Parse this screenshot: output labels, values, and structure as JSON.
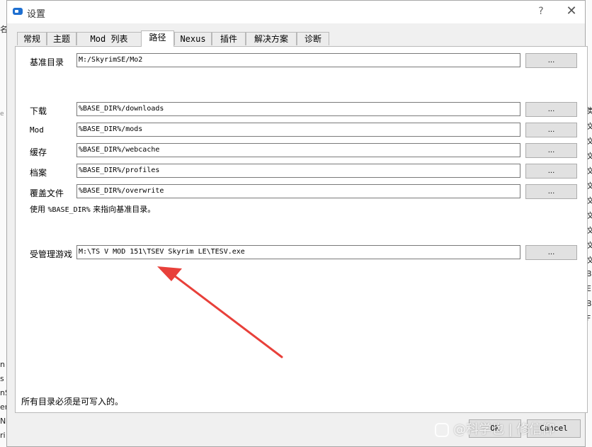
{
  "window": {
    "title": "设置",
    "help_symbol": "?",
    "close_symbol": "✕"
  },
  "tabs": [
    {
      "label": "常规"
    },
    {
      "label": "主题"
    },
    {
      "label": "Mod 列表"
    },
    {
      "label": "路径"
    },
    {
      "label": "Nexus"
    },
    {
      "label": "插件"
    },
    {
      "label": "解决方案"
    },
    {
      "label": "诊断"
    }
  ],
  "active_tab": "路径",
  "paths": {
    "base": {
      "label": "基准目录",
      "value": "M:/SkyrimSE/Mo2",
      "browse": "..."
    },
    "downloads": {
      "label": "下载",
      "value": "%BASE_DIR%/downloads",
      "browse": "..."
    },
    "mods": {
      "label": "Mod",
      "value": "%BASE_DIR%/mods",
      "browse": "..."
    },
    "cache": {
      "label": "缓存",
      "value": "%BASE_DIR%/webcache",
      "browse": "..."
    },
    "profiles": {
      "label": "档案",
      "value": "%BASE_DIR%/profiles",
      "browse": "..."
    },
    "overwrite": {
      "label": "覆盖文件",
      "value": "%BASE_DIR%/overwrite",
      "browse": "..."
    },
    "managed_game": {
      "label": "受管理游戏",
      "value": "M:\\TS V MOD 151\\TSEV Skyrim LE\\TESV.exe",
      "browse": "..."
    }
  },
  "notes": {
    "base_dir_prefix": "使用 ",
    "base_dir_token": "%BASE_DIR%",
    "base_dir_suffix": " 来指向基准目录。",
    "writable": "所有目录必须是可写入的。"
  },
  "buttons": {
    "ok": "OK",
    "cancel": "Cancel"
  },
  "annotation": {
    "arrow_color": "#e8403a"
  },
  "watermark": {
    "text": "@科学也 | 修信仰"
  },
  "background": {
    "left_edge_glyphs": [
      "名",
      "e",
      "n",
      "s",
      "nS",
      "er",
      "N",
      "ri"
    ],
    "right_edge_glyphs": [
      "类",
      "文",
      "文",
      "文",
      "文",
      "文",
      "文",
      "文",
      "文",
      "文",
      "文",
      "B",
      "E",
      "B",
      "F"
    ]
  }
}
